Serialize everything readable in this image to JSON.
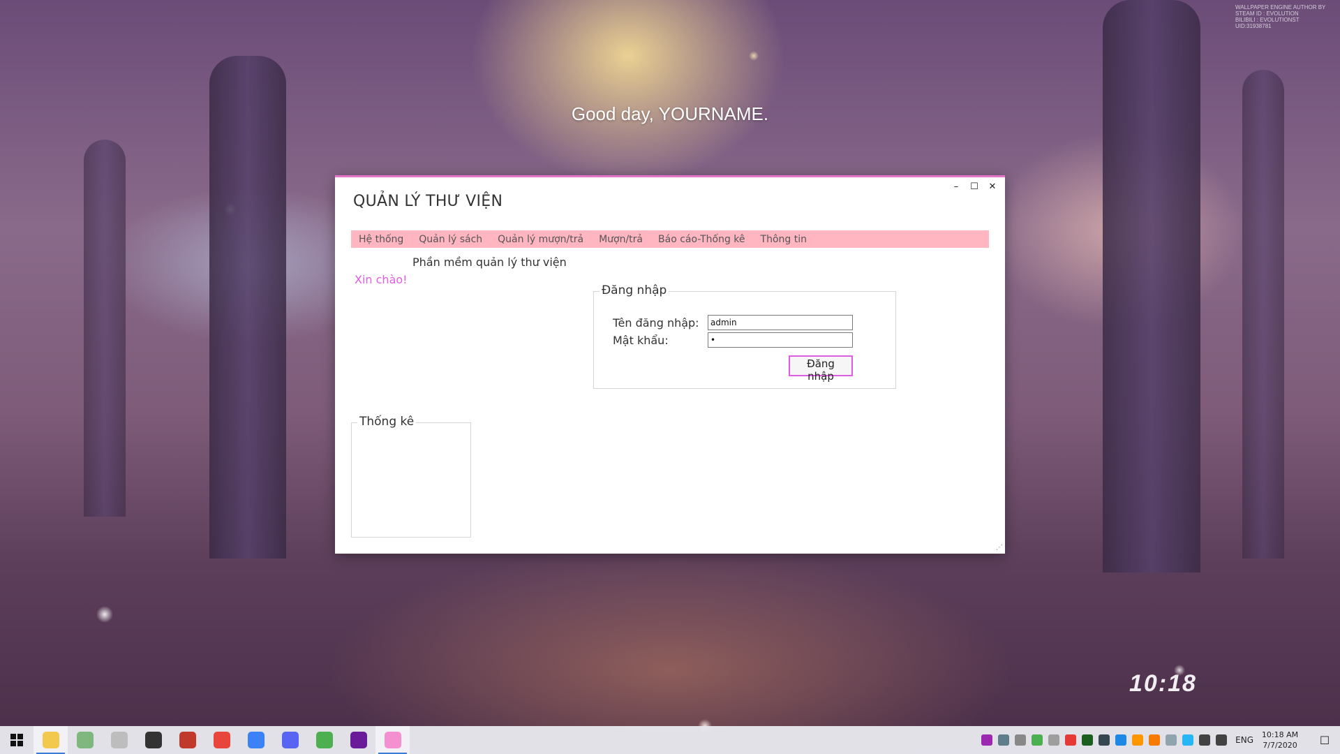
{
  "desktop": {
    "greeting": "Good day, YOURNAME.",
    "wallpaper_clock": "10:18",
    "wallpaper_credit": "WALLPAPER ENGINE AUTHOR BY\nSTEAM ID : EVOLUTION\nBILIBILI : EVOLUTIONST\nUID:31938781"
  },
  "window": {
    "accent_color": "#e573c8",
    "title": "QUẢN LÝ THƯ VIỆN",
    "controls": {
      "minimize": "–",
      "maximize": "☐",
      "close": "✕"
    },
    "menu": [
      "Hệ thống",
      "Quản lý sách",
      "Quản lý mượn/trả",
      "Mượn/trả",
      "Báo cáo-Thống kê",
      "Thông tin"
    ],
    "menu_color": "#ffb6c1",
    "subtitle": "Phần mềm quản lý thư viện",
    "hello": "Xin chào!",
    "login": {
      "group_label": "Đăng nhập",
      "username_label": "Tên đăng nhập:",
      "username_value": "admin",
      "password_label": "Mật khẩu:",
      "password_value": "•",
      "button_label": "Đăng nhập"
    },
    "stats": {
      "group_label": "Thống kê"
    }
  },
  "taskbar": {
    "apps": [
      {
        "icon": "file-explorer-icon",
        "color": "#f2c94c",
        "active": true
      },
      {
        "icon": "pinwheel-app-icon",
        "color": "#7fb77e",
        "active": false
      },
      {
        "icon": "disc-app-icon",
        "color": "#bdbdbd",
        "active": false
      },
      {
        "icon": "steam-like-icon",
        "color": "#333333",
        "active": false
      },
      {
        "icon": "game-launcher-icon",
        "color": "#c0392b",
        "active": false
      },
      {
        "icon": "chrome-icon",
        "color": "#e8453c",
        "active": false
      },
      {
        "icon": "browser-icon",
        "color": "#3b82f6",
        "active": false
      },
      {
        "icon": "discord-icon",
        "color": "#5865f2",
        "active": false
      },
      {
        "icon": "notepad-icon",
        "color": "#4caf50",
        "active": false
      },
      {
        "icon": "purple-app-icon",
        "color": "#6a1b9a",
        "active": false
      },
      {
        "icon": "library-app-icon",
        "color": "#f48fd0",
        "active": true
      }
    ],
    "tray_icons": [
      {
        "icon": "tray-app-1-icon",
        "color": "#9c27b0"
      },
      {
        "icon": "tray-app-2-icon",
        "color": "#607d8b"
      },
      {
        "icon": "tray-usb-icon",
        "color": "#888888"
      },
      {
        "icon": "tray-app-3-icon",
        "color": "#4caf50"
      },
      {
        "icon": "tray-cloud-icon",
        "color": "#9e9e9e"
      },
      {
        "icon": "tray-vivaldi-icon",
        "color": "#e53935"
      },
      {
        "icon": "tray-nvidia-icon",
        "color": "#1b5e20"
      },
      {
        "icon": "tray-steam-icon",
        "color": "#37474f"
      },
      {
        "icon": "tray-app-4-icon",
        "color": "#1e88e5"
      },
      {
        "icon": "tray-app-5-icon",
        "color": "#ff9800"
      },
      {
        "icon": "tray-app-6-icon",
        "color": "#f57c00"
      },
      {
        "icon": "tray-app-7-icon",
        "color": "#90a4ae"
      },
      {
        "icon": "tray-app-8-icon",
        "color": "#29b6f6"
      },
      {
        "icon": "tray-network-icon",
        "color": "#424242"
      },
      {
        "icon": "tray-volume-icon",
        "color": "#424242"
      }
    ],
    "language": "ENG",
    "time": "10:18 AM",
    "date": "7/7/2020",
    "notification_icon": "☐"
  }
}
